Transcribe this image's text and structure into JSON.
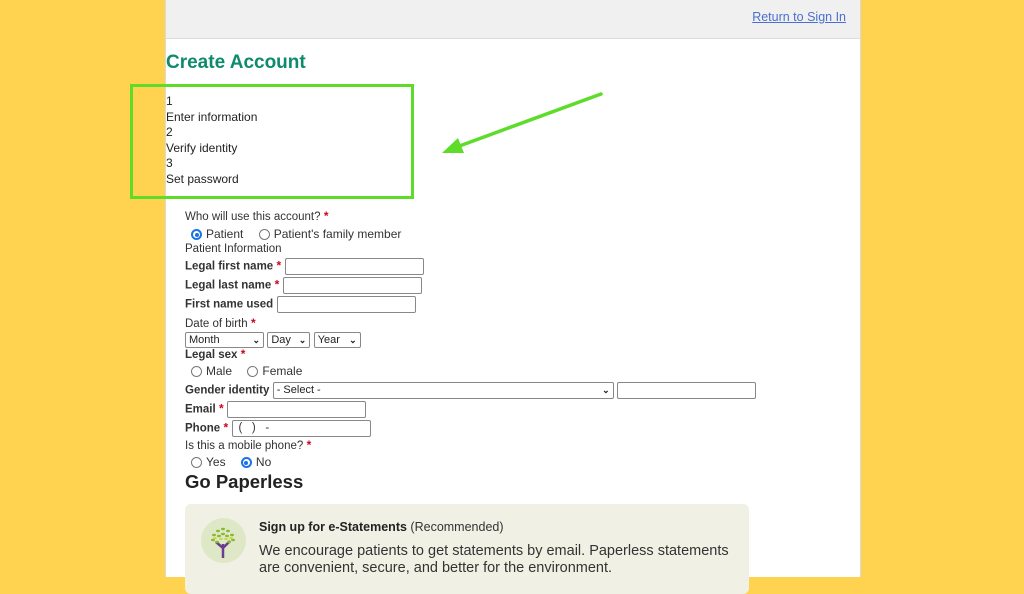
{
  "header": {
    "return_link": "Return to Sign In"
  },
  "page_title": "Create Account",
  "steps": [
    {
      "number": "1",
      "label": "Enter information"
    },
    {
      "number": "2",
      "label": "Verify identity"
    },
    {
      "number": "3",
      "label": "Set password"
    }
  ],
  "form": {
    "who_label": "Who will use this account?",
    "who_options": [
      "Patient",
      "Patient's family member"
    ],
    "who_selected": "Patient",
    "section_label": "Patient Information",
    "legal_first_name_label": "Legal first name",
    "legal_last_name_label": "Legal last name",
    "first_name_used_label": "First name used",
    "dob_label": "Date of birth",
    "dob_month": "Month",
    "dob_day": "Day",
    "dob_year": "Year",
    "legal_sex_label": "Legal sex",
    "sex_options": [
      "Male",
      "Female"
    ],
    "gender_identity_label": "Gender identity",
    "gender_identity_value": "- Select -",
    "email_label": "Email",
    "phone_label": "Phone",
    "phone_value": "(   )   -",
    "mobile_label": "Is this a mobile phone?",
    "mobile_options": [
      "Yes",
      "No"
    ],
    "mobile_selected": "No",
    "required_mark": "*"
  },
  "paperless": {
    "heading": "Go Paperless",
    "title": "Sign up for e-Statements",
    "title_suffix": "(Recommended)",
    "body": "We encourage patients to get statements by email. Paperless statements are convenient, secure, and better for the environment."
  },
  "colors": {
    "background": "#FFD24F",
    "title": "#0e8a6d",
    "annotation": "#5ddc2a",
    "link": "#4a6fd0"
  }
}
